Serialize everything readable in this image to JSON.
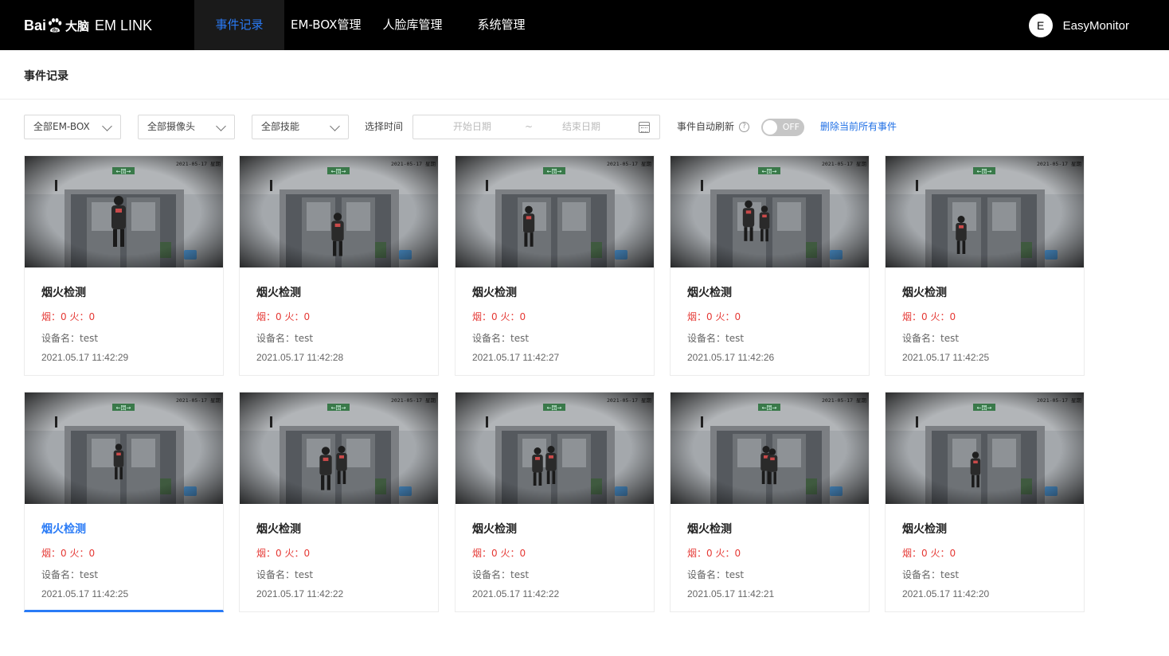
{
  "header": {
    "logo_prefix": "Bai",
    "logo_brand": "大脑",
    "logo_product": "EM LINK",
    "nav": [
      {
        "label": "事件记录",
        "active": true
      },
      {
        "label": "EM-BOX管理",
        "active": false
      },
      {
        "label": "人脸库管理",
        "active": false
      },
      {
        "label": "系统管理",
        "active": false
      }
    ],
    "user_initial": "E",
    "user_name": "EasyMonitor"
  },
  "page_title": "事件记录",
  "filters": {
    "embox": "全部EM-BOX",
    "camera": "全部摄像头",
    "skill": "全部技能",
    "time_label": "选择时间",
    "start_placeholder": "开始日期",
    "separator": "~",
    "end_placeholder": "结束日期",
    "auto_refresh_label": "事件自动刷新",
    "toggle_state": "OFF",
    "delete_all": "删除当前所有事件"
  },
  "events": [
    {
      "title": "烟火检测",
      "counts": "烟：0  火：0",
      "device": "设备名：test",
      "time": "2021.05.17 11:42:29",
      "selected": false
    },
    {
      "title": "烟火检测",
      "counts": "烟：0  火：0",
      "device": "设备名：test",
      "time": "2021.05.17 11:42:28",
      "selected": false
    },
    {
      "title": "烟火检测",
      "counts": "烟：0  火：0",
      "device": "设备名：test",
      "time": "2021.05.17 11:42:27",
      "selected": false
    },
    {
      "title": "烟火检测",
      "counts": "烟：0  火：0",
      "device": "设备名：test",
      "time": "2021.05.17 11:42:26",
      "selected": false
    },
    {
      "title": "烟火检测",
      "counts": "烟：0  火：0",
      "device": "设备名：test",
      "time": "2021.05.17 11:42:25",
      "selected": false
    },
    {
      "title": "烟火检测",
      "counts": "烟：0  火：0",
      "device": "设备名：test",
      "time": "2021.05.17 11:42:25",
      "selected": true
    },
    {
      "title": "烟火检测",
      "counts": "烟：0  火：0",
      "device": "设备名：test",
      "time": "2021.05.17 11:42:22",
      "selected": false
    },
    {
      "title": "烟火检测",
      "counts": "烟：0  火：0",
      "device": "设备名：test",
      "time": "2021.05.17 11:42:22",
      "selected": false
    },
    {
      "title": "烟火检测",
      "counts": "烟：0  火：0",
      "device": "设备名：test",
      "time": "2021.05.17 11:42:21",
      "selected": false
    },
    {
      "title": "烟火检测",
      "counts": "烟：0  火：0",
      "device": "设备名：test",
      "time": "2021.05.17 11:42:20",
      "selected": false
    }
  ],
  "thumbnail": {
    "overlay_date": "2021-05-17 星期",
    "exit_sign": "←団→"
  },
  "colors": {
    "accent": "#2a7bf6",
    "alert": "#e53935",
    "navbar": "#000000",
    "link": "#1f6fe5"
  }
}
